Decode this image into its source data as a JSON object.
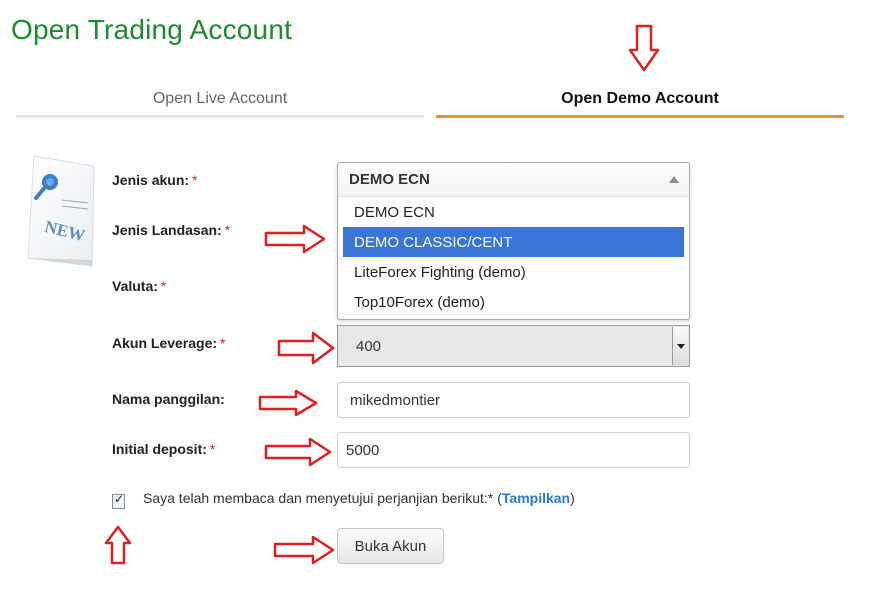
{
  "header": {
    "title": "Open Trading Account"
  },
  "tabs": [
    {
      "label": "Open Live Account",
      "active": false
    },
    {
      "label": "Open Demo Account",
      "active": true
    }
  ],
  "sticker": {
    "text": "NEW"
  },
  "form": {
    "account_type": {
      "label": "Jenis akun:",
      "required_mark": "*",
      "selected": "DEMO ECN",
      "options": [
        "DEMO ECN",
        "DEMO CLASSIC/CENT",
        "LiteForex Fighting (demo)",
        "Top10Forex (demo)"
      ],
      "highlighted_option": "DEMO CLASSIC/CENT"
    },
    "platform": {
      "label": "Jenis Landasan:",
      "required_mark": "*"
    },
    "currency": {
      "label": "Valuta:",
      "required_mark": "*"
    },
    "leverage": {
      "label": "Akun Leverage:",
      "required_mark": "*",
      "value": "400"
    },
    "nickname": {
      "label": "Nama panggilan:",
      "value": "mikedmontier"
    },
    "deposit": {
      "label": "Initial deposit:",
      "required_mark": "*",
      "value": "5000"
    },
    "agreement": {
      "text": "Saya telah membaca dan menyetujui perjanjian berikut:*",
      "open_paren": "(",
      "link": "Tampilkan",
      "close_paren": ")",
      "checked": true
    },
    "submit_label": "Buka Akun"
  },
  "colors": {
    "title_green": "#1e8a2e",
    "tab_active_orange": "#f0922b",
    "required_red": "#e02020",
    "highlight_blue": "#3875d7",
    "arrow_red": "#e02020"
  }
}
